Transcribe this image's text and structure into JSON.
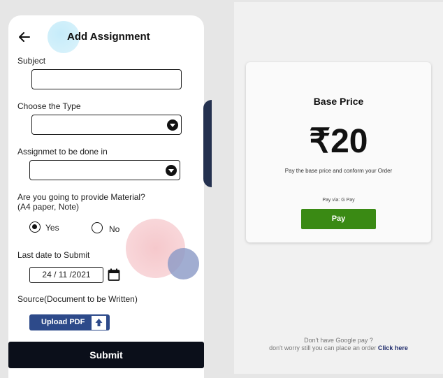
{
  "form": {
    "title": "Add Assignment",
    "subject_label": "Subject",
    "subject_value": "",
    "type_label": "Choose the Type",
    "type_value": "",
    "done_in_label": "Assignmet to be done in",
    "done_in_value": "",
    "material_label_1": "Are you going to  provide  Material?",
    "material_label_2": "(A4 paper, Note)",
    "material_options": [
      {
        "label": "Yes",
        "selected": true
      },
      {
        "label": "No",
        "selected": false
      }
    ],
    "date_label": "Last date to Submit",
    "date_value": "24 / 11 /2021",
    "source_label": "Source(Document to be Written)",
    "upload_label": "Upload PDF",
    "submit_label": "Submit"
  },
  "payment": {
    "title": "Base Price",
    "amount": "₹20",
    "description": "Pay the base price and conform your Order",
    "pay_via": "Pay via:",
    "gpay_label": "G Pay",
    "pay_button": "Pay",
    "footer_line1": "Don't have Google pay ?",
    "footer_line2": "don't worry still you can place an order",
    "footer_link": "Click here"
  },
  "colors": {
    "submit_bg": "#0b0f1a",
    "upload_bg": "#2d4a8a",
    "pay_bg": "#3a8a14",
    "link": "#1f2b6b"
  }
}
